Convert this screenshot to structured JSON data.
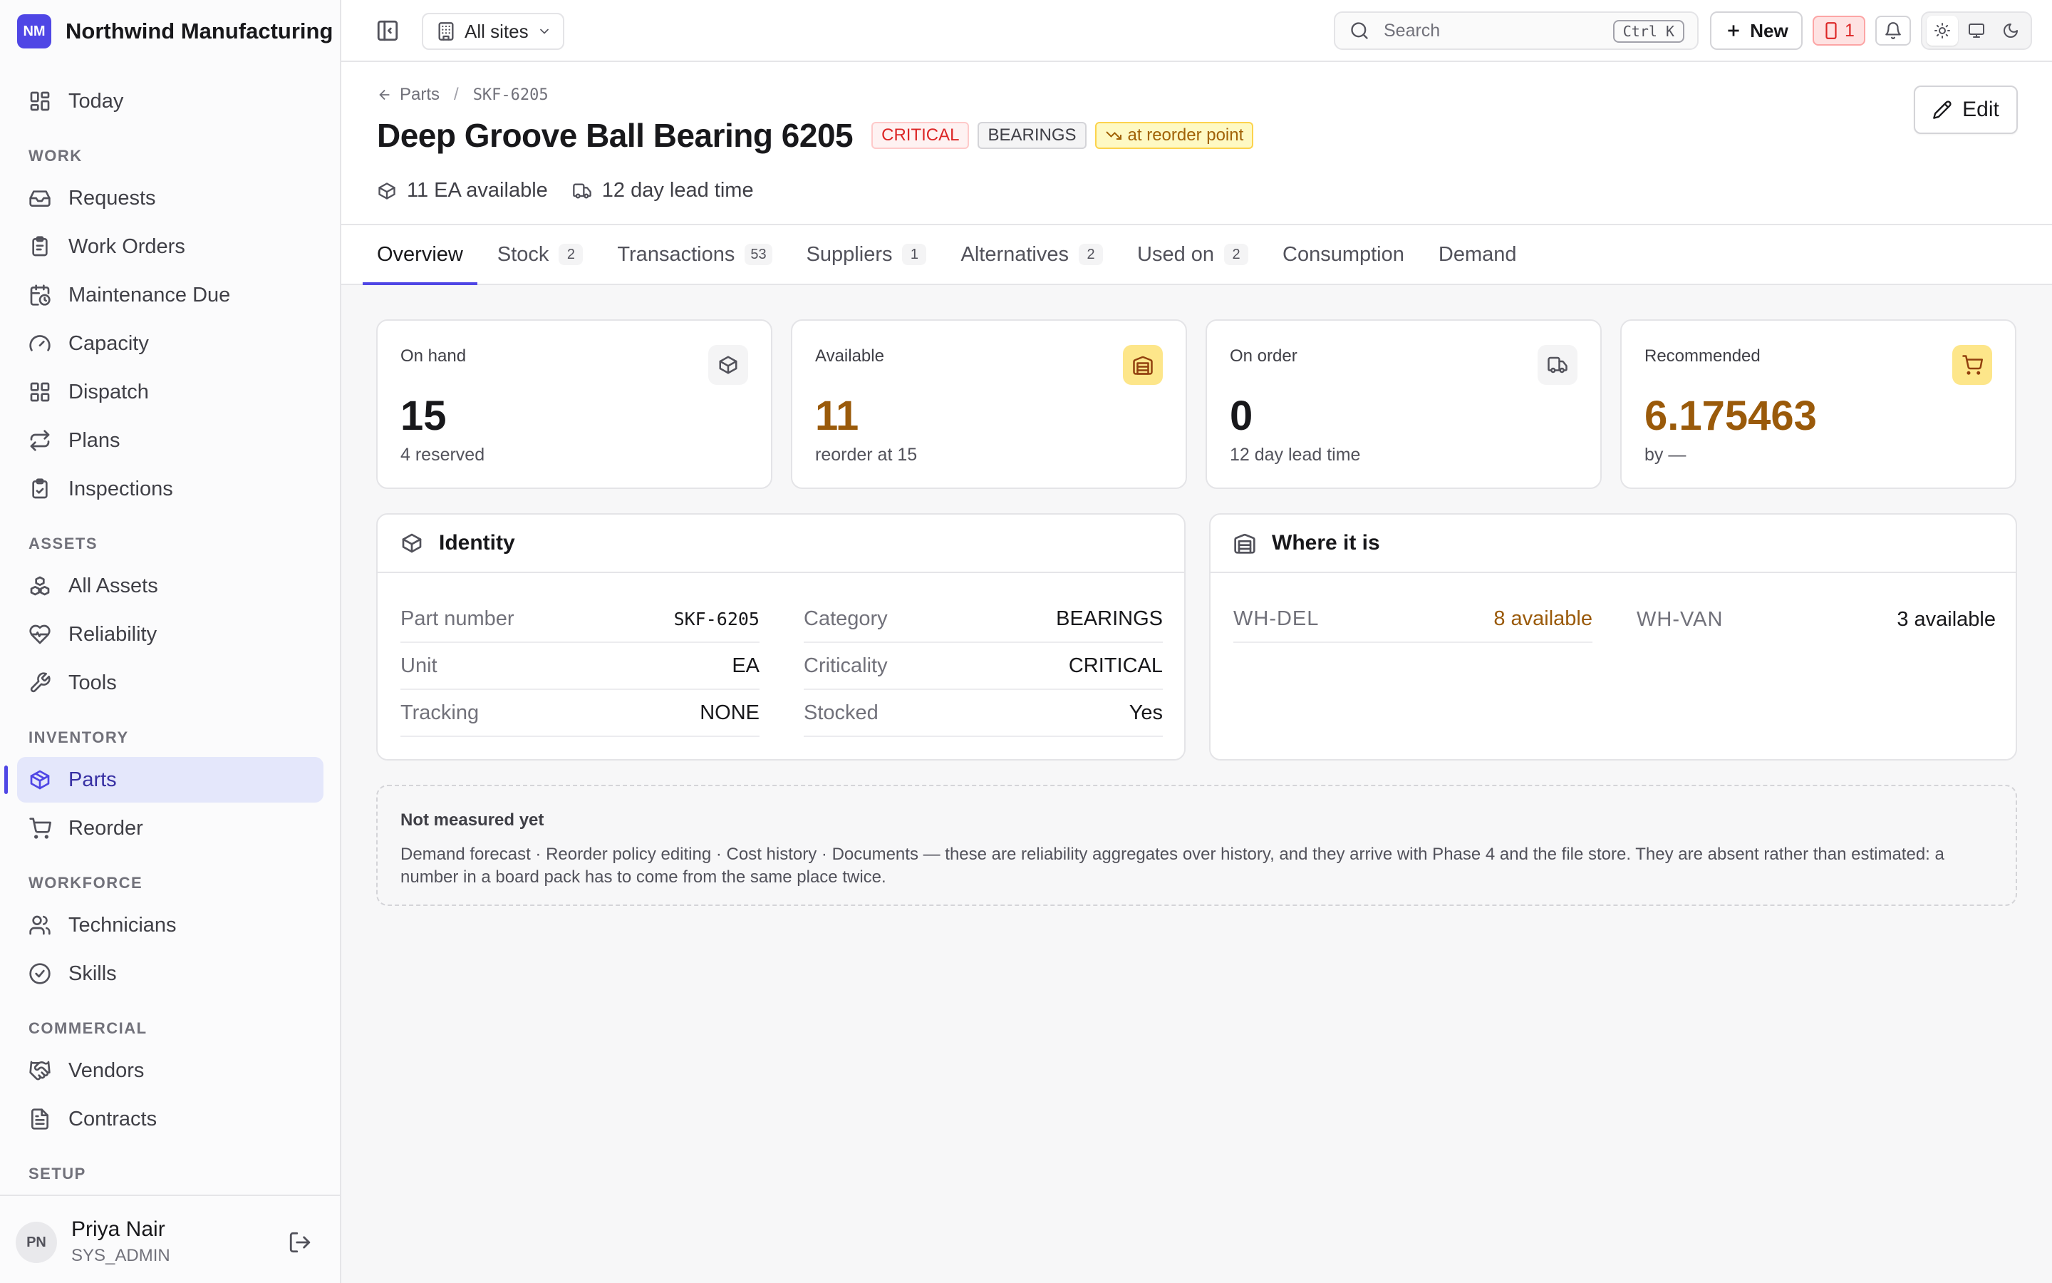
{
  "app": {
    "initials": "NM",
    "name": "Northwind Manufacturing",
    "brand_color": "#4f46e5"
  },
  "sidebar": {
    "top": {
      "label": "Today",
      "icon": "dashboard-icon"
    },
    "sections": [
      {
        "title": "WORK",
        "items": [
          {
            "label": "Requests",
            "icon": "inbox-icon"
          },
          {
            "label": "Work Orders",
            "icon": "clipboard-icon"
          },
          {
            "label": "Maintenance Due",
            "icon": "calendar-clock-icon"
          },
          {
            "label": "Capacity",
            "icon": "gauge-icon"
          },
          {
            "label": "Dispatch",
            "icon": "grid-icon"
          },
          {
            "label": "Plans",
            "icon": "repeat-icon"
          },
          {
            "label": "Inspections",
            "icon": "checklist-icon"
          }
        ]
      },
      {
        "title": "ASSETS",
        "items": [
          {
            "label": "All Assets",
            "icon": "boxes-icon"
          },
          {
            "label": "Reliability",
            "icon": "heart-pulse-icon"
          },
          {
            "label": "Tools",
            "icon": "wrench-icon"
          }
        ]
      },
      {
        "title": "INVENTORY",
        "items": [
          {
            "label": "Parts",
            "icon": "package-icon",
            "active": true
          },
          {
            "label": "Reorder",
            "icon": "cart-icon"
          }
        ]
      },
      {
        "title": "WORKFORCE",
        "items": [
          {
            "label": "Technicians",
            "icon": "users-icon"
          },
          {
            "label": "Skills",
            "icon": "badge-check-icon"
          }
        ]
      },
      {
        "title": "COMMERCIAL",
        "items": [
          {
            "label": "Vendors",
            "icon": "handshake-icon"
          },
          {
            "label": "Contracts",
            "icon": "file-text-icon"
          }
        ]
      },
      {
        "title": "SETUP",
        "items": []
      }
    ],
    "user": {
      "initials": "PN",
      "name": "Priya Nair",
      "role": "SYS_ADMIN"
    }
  },
  "topbar": {
    "site_label": "All sites",
    "search_placeholder": "Search",
    "search_shortcut": "Ctrl K",
    "new_label": "New",
    "alert_count": "1"
  },
  "header": {
    "breadcrumb_parent": "Parts",
    "breadcrumb_code": "SKF-6205",
    "title": "Deep Groove Ball Bearing 6205",
    "badges": {
      "criticality": "CRITICAL",
      "category": "BEARINGS",
      "reorder": "at reorder point"
    },
    "meta": {
      "available": "11 EA available",
      "lead_time": "12 day lead time"
    },
    "edit_label": "Edit"
  },
  "tabs": [
    {
      "label": "Overview",
      "count": "",
      "active": true
    },
    {
      "label": "Stock",
      "count": "2"
    },
    {
      "label": "Transactions",
      "count": "53"
    },
    {
      "label": "Suppliers",
      "count": "1"
    },
    {
      "label": "Alternatives",
      "count": "2"
    },
    {
      "label": "Used on",
      "count": "2"
    },
    {
      "label": "Consumption",
      "count": ""
    },
    {
      "label": "Demand",
      "count": ""
    }
  ],
  "stats": [
    {
      "label": "On hand",
      "value": "15",
      "sub": "4 reserved",
      "icon": "package-icon"
    },
    {
      "label": "Available",
      "value": "11",
      "sub": "reorder at 15",
      "icon": "warehouse-icon",
      "warn": true
    },
    {
      "label": "On order",
      "value": "0",
      "sub": "12 day lead time",
      "icon": "truck-icon"
    },
    {
      "label": "Recommended",
      "value": "6.175463",
      "sub": "by —",
      "icon": "cart-icon",
      "warn": true
    }
  ],
  "identity": {
    "title": "Identity",
    "rows": [
      {
        "k": "Part number",
        "v": "SKF-6205",
        "mono": true
      },
      {
        "k": "Category",
        "v": "BEARINGS"
      },
      {
        "k": "Unit",
        "v": "EA"
      },
      {
        "k": "Criticality",
        "v": "CRITICAL"
      },
      {
        "k": "Tracking",
        "v": "NONE"
      },
      {
        "k": "Stocked",
        "v": "Yes"
      }
    ]
  },
  "where": {
    "title": "Where it is",
    "locations": [
      {
        "k": "WH-DEL",
        "v": "8 available",
        "warn": true
      },
      {
        "k": "WH-VAN",
        "v": "3 available"
      }
    ]
  },
  "note": {
    "title": "Not measured yet",
    "body": "Demand forecast · Reorder policy editing · Cost history · Documents — these are reliability aggregates over history, and they arrive with Phase 4 and the file store. They are absent rather than estimated: a number in a board pack has to come from the same place twice."
  }
}
